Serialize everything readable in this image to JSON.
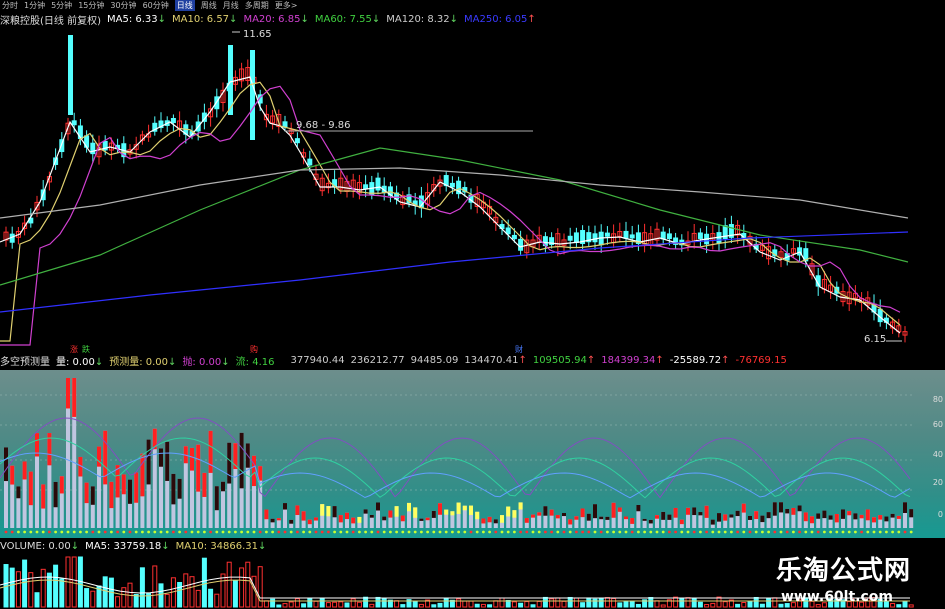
{
  "toolbar": {
    "items": [
      "分时",
      "1分钟",
      "5分钟",
      "15分钟",
      "30分钟",
      "60分钟",
      "日线",
      "周线",
      "月线",
      "多周期",
      "更多>"
    ],
    "active_index": 6
  },
  "main_legend": {
    "title": "深粮控股(日线 前复权)",
    "ma5": "MA5: 6.33",
    "ma10": "MA10: 6.57",
    "ma20": "MA20: 6.85",
    "ma60": "MA60: 7.55",
    "ma120": "MA120: 8.32",
    "ma250": "MA250: 6.05"
  },
  "price_labels": {
    "high": "11.65",
    "range_line": "9.68 - 9.86",
    "low": "6.15"
  },
  "indicator_legend": {
    "name": "多空预测量",
    "vol": "量: 0.00",
    "forecast": "预测量: 0.00",
    "sell": "抛: 0.00",
    "flow": "流: 4.16",
    "v1": "377940.44",
    "v2": "236212.77",
    "v3": "94485.09",
    "v4": "134470.41",
    "v5": "109505.94",
    "v6": "184399.34",
    "v7": "-25589.72",
    "v8": "-76769.15"
  },
  "volume_legend": {
    "vol": "VOLUME: 0.00",
    "ma5": "MA5: 33759.18",
    "ma10": "MA10: 34866.31"
  },
  "axis": {
    "ind_ticks": [
      "80",
      "60",
      "40",
      "20",
      "0"
    ]
  },
  "tags": {
    "t1": "涨",
    "t2": "跌",
    "t3": "购",
    "t4": "财"
  },
  "watermark": {
    "cn": "乐淘公式网",
    "url": "www.60lt.com"
  },
  "colors": {
    "up": "#ff3030",
    "down": "#54ffff",
    "ma5": "#ffffff",
    "ma10": "#e0d070",
    "ma20": "#d040d0",
    "ma60": "#40b040",
    "ma120": "#b0b0b0",
    "ma250": "#3030ff"
  }
}
